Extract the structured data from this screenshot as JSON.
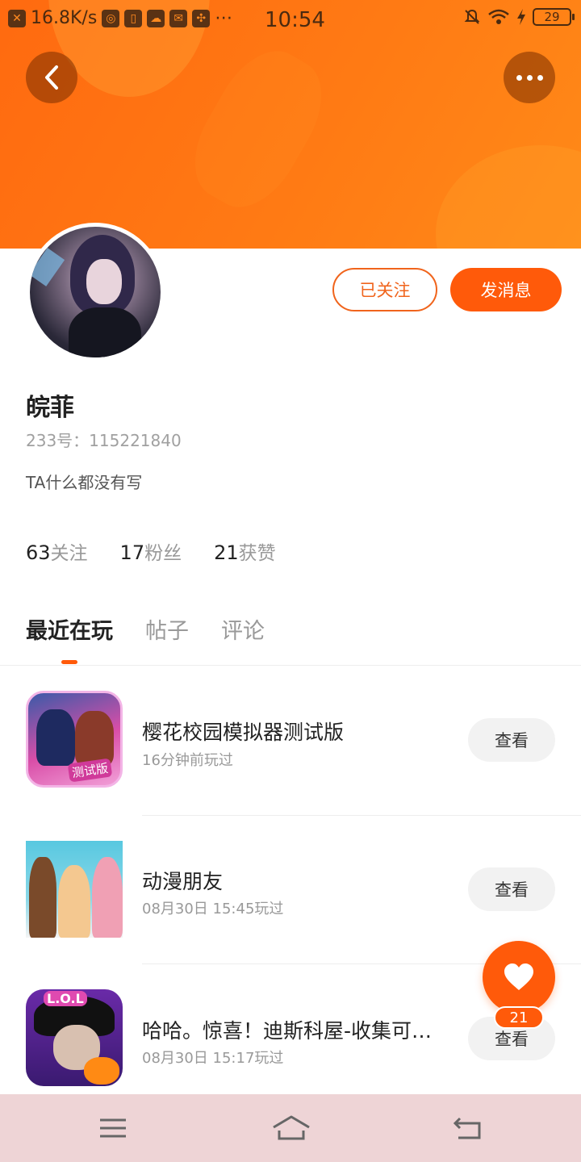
{
  "status_bar": {
    "net_speed": "16.8K/s",
    "more": "⋯",
    "time": "10:54",
    "battery": "29"
  },
  "profile": {
    "name": "皖菲",
    "id_text": "233号：115221840",
    "bio": "TA什么都没有写",
    "followed_label": "已关注",
    "message_label": "发消息"
  },
  "stats": [
    {
      "num": "63",
      "label": "关注"
    },
    {
      "num": "17",
      "label": "粉丝"
    },
    {
      "num": "21",
      "label": "获赞"
    }
  ],
  "tabs": [
    {
      "label": "最近在玩",
      "active": true
    },
    {
      "label": "帖子",
      "active": false
    },
    {
      "label": "评论",
      "active": false
    }
  ],
  "games": [
    {
      "title": "樱花校园模拟器测试版",
      "time": "16分钟前玩过",
      "button": "查看",
      "badge": "测试版"
    },
    {
      "title": "动漫朋友",
      "time": "08月30日 15:45玩过",
      "button": "查看"
    },
    {
      "title": "哈哈。惊喜！迪斯科屋-收集可…",
      "time": "08月30日 15:17玩过",
      "button": "查看",
      "logo": "L.O.L"
    }
  ],
  "like": {
    "count": "21"
  },
  "icons": {
    "back": "chevron-left-icon",
    "more": "more-dots-icon",
    "like": "heart-icon",
    "nav_menu": "menu-icon",
    "nav_home": "home-icon",
    "nav_back": "back-icon"
  },
  "colors": {
    "accent": "#ff5a0a",
    "banner": "#ff7a14",
    "navbar": "#eed4d6"
  }
}
